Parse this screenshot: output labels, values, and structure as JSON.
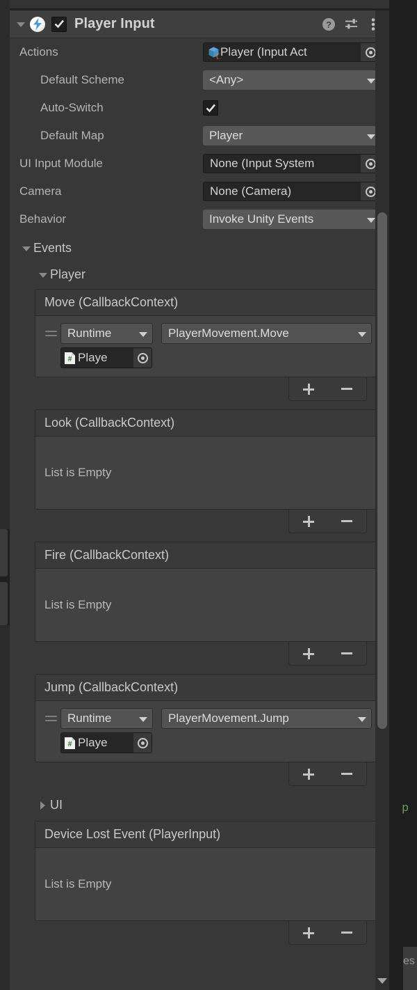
{
  "window": {
    "component_title": "Player Input",
    "enabled": true,
    "icons": {
      "foldout": "triangle-down-icon",
      "component": "player-input-bolt-icon",
      "enable_checkbox": "checkmark-icon",
      "help": "help-icon",
      "preset": "preset-sliders-icon",
      "menu": "kebab-menu-icon"
    }
  },
  "properties": [
    {
      "label": "Actions",
      "indent": false,
      "type": "object",
      "value": "Player (Input Act",
      "icon": "input-actions-asset-icon"
    },
    {
      "label": "Default Scheme",
      "indent": true,
      "type": "popup",
      "value": "<Any>"
    },
    {
      "label": "Auto-Switch",
      "indent": true,
      "type": "toggle",
      "value": true
    },
    {
      "label": "Default Map",
      "indent": true,
      "type": "popup",
      "value": "Player"
    },
    {
      "label": "UI Input Module",
      "indent": false,
      "type": "object",
      "value": "None (Input System",
      "icon": "none-icon"
    },
    {
      "label": "Camera",
      "indent": false,
      "type": "object",
      "value": "None (Camera)",
      "icon": "none-icon"
    },
    {
      "label": "Behavior",
      "indent": false,
      "type": "popup",
      "value": "Invoke Unity Events"
    }
  ],
  "events": {
    "label": "Events",
    "expanded": true,
    "groups": [
      {
        "label": "Player",
        "expanded": true
      },
      {
        "label": "UI",
        "expanded": false
      }
    ]
  },
  "event_lists": [
    {
      "title": "Move (CallbackContext)",
      "empty_text": null,
      "entries": [
        {
          "mode": "Runtime",
          "function": "PlayerMovement.Move",
          "target": "Playe",
          "target_icon": "cs-script-icon",
          "drag_handle": "drag-handle-icon"
        }
      ],
      "footer": {
        "add": "+",
        "remove": "−"
      }
    },
    {
      "title": "Look (CallbackContext)",
      "empty_text": "List is Empty",
      "entries": [],
      "footer": {
        "add": "+",
        "remove": "−"
      }
    },
    {
      "title": "Fire (CallbackContext)",
      "empty_text": "List is Empty",
      "entries": [],
      "footer": {
        "add": "+",
        "remove": "−"
      }
    },
    {
      "title": "Jump (CallbackContext)",
      "empty_text": null,
      "entries": [
        {
          "mode": "Runtime",
          "function": "PlayerMovement.Jump",
          "target": "Playe",
          "target_icon": "cs-script-icon",
          "drag_handle": "drag-handle-icon"
        }
      ],
      "footer": {
        "add": "+",
        "remove": "−"
      }
    }
  ],
  "device_lost": {
    "title": "Device Lost Event (PlayerInput)",
    "empty_text": "List is Empty",
    "footer": {
      "add": "+",
      "remove": "−"
    }
  },
  "scrollbar": {
    "name": "inspector-scrollbar",
    "down_arrow": "triangle-down-icon"
  },
  "background": {
    "code_fragment": "p",
    "text_fragment": "es"
  },
  "colors": {
    "panel": "#383838",
    "header": "#3f3f3f",
    "popup": "#585858",
    "object_field": "#262626",
    "text": "#d2d2d2",
    "label": "#b4b4b4",
    "accent_blue": "#4a9ad4",
    "accent_orange": "#d2691e",
    "accent_green": "#2e7d32",
    "code_green": "#6a9955"
  }
}
